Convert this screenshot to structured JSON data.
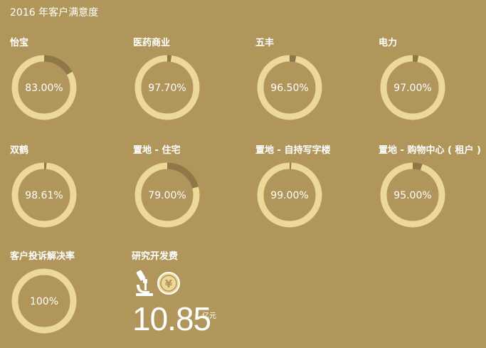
{
  "page_title": "2016 年客户满意度",
  "colors": {
    "background": "#b0965a",
    "ring": "#ecd99a",
    "ring_gap": "#8f7848",
    "text": "#ffffff"
  },
  "chart_data": {
    "type": "donut-grid",
    "title": "2016 年客户满意度",
    "value_unit": "%",
    "range": [
      0,
      100
    ],
    "items": [
      {
        "label": "怡宝",
        "value": 83.0,
        "display": "83.00%"
      },
      {
        "label": "医药商业",
        "value": 97.7,
        "display": "97.70%"
      },
      {
        "label": "五丰",
        "value": 96.5,
        "display": "96.50%"
      },
      {
        "label": "电力",
        "value": 97.0,
        "display": "97.00%"
      },
      {
        "label": "双鹤",
        "value": 98.61,
        "display": "98.61%"
      },
      {
        "label": "置地 - 住宅",
        "value": 79.0,
        "display": "79.00%"
      },
      {
        "label": "置地 - 自持写字楼",
        "value": 99.0,
        "display": "99.00%"
      },
      {
        "label": "置地 - 购物中心 ( 租户 )",
        "value": 95.0,
        "display": "95.00%"
      },
      {
        "label": "客户投诉解决率",
        "value": 100,
        "display": "100%"
      }
    ]
  },
  "rd": {
    "label": "研究开发费",
    "value": "10.85",
    "unit": "亿元",
    "icons": [
      "microscope-icon",
      "yuan-coin-icon"
    ],
    "coin_symbol": "¥"
  }
}
